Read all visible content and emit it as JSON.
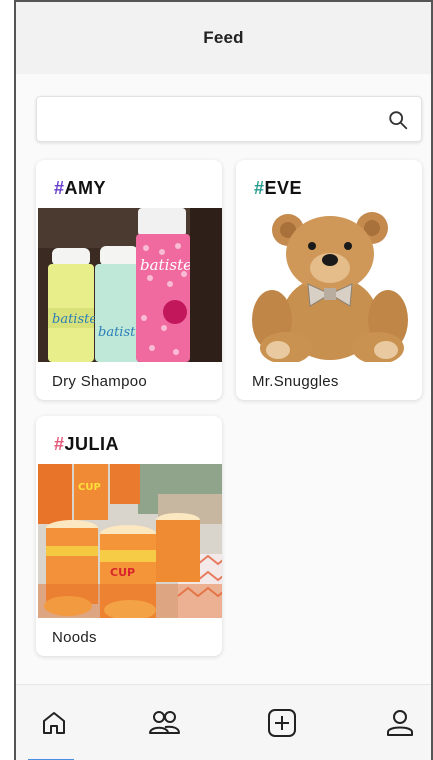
{
  "header": {
    "title": "Feed"
  },
  "search": {
    "value": "",
    "placeholder": ""
  },
  "cards": [
    {
      "hash": "#",
      "tag": "AMY",
      "hash_color": "#6a3fc9",
      "caption": "Dry Shampoo",
      "image": "dry-shampoo-bottles"
    },
    {
      "hash": "#",
      "tag": "EVE",
      "hash_color": "#2a9d8f",
      "caption": "Mr.Snuggles",
      "image": "teddy-bear"
    },
    {
      "hash": "#",
      "tag": "JULIA",
      "hash_color": "#e25a7a",
      "caption": "Noods",
      "image": "cup-noodles"
    }
  ],
  "bottom_nav": {
    "items": [
      {
        "icon": "home-icon",
        "active": true
      },
      {
        "icon": "friends-icon",
        "active": false
      },
      {
        "icon": "add-post-icon",
        "active": false
      },
      {
        "icon": "profile-icon",
        "active": false
      }
    ],
    "active_color": "#4a90e2"
  }
}
